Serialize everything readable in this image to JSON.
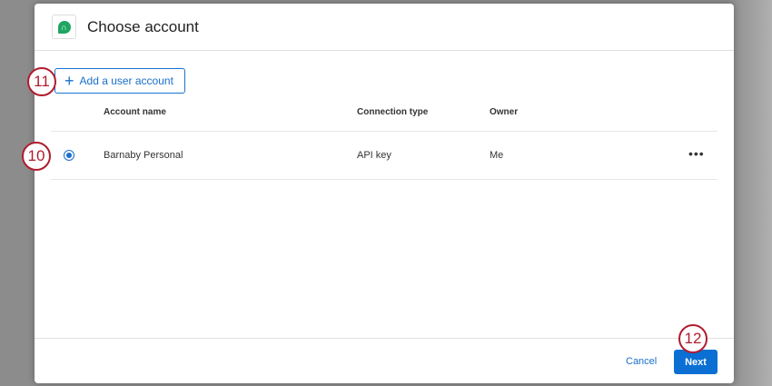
{
  "dialog": {
    "title": "Choose account",
    "logo_icon": "headset-icon"
  },
  "add_account_label": "Add a user account",
  "table": {
    "headers": [
      "Account name",
      "Connection type",
      "Owner"
    ],
    "rows": [
      {
        "name": "Barnaby Personal",
        "type": "API key",
        "owner": "Me",
        "selected": true
      }
    ]
  },
  "more_label": "•••",
  "footer": {
    "cancel": "Cancel",
    "next": "Next"
  },
  "callouts": [
    "11",
    "10",
    "12"
  ],
  "colors": {
    "accent": "#0b6fd4",
    "callout": "#b01c2e"
  }
}
